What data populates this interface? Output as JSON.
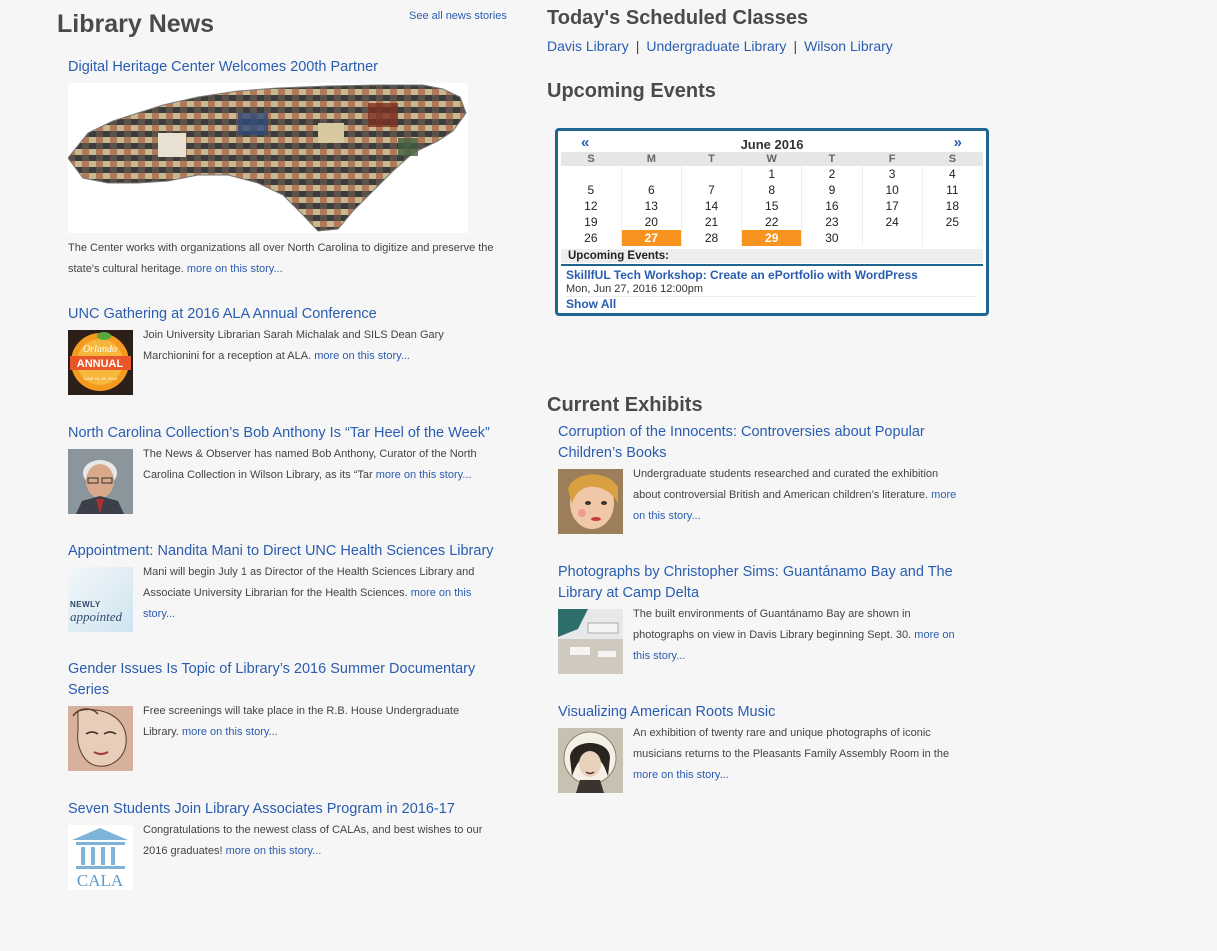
{
  "news": {
    "heading": "Library News",
    "see_all": "See all news stories",
    "more_label": "more on this story...",
    "stories": [
      {
        "title": "Digital Heritage Center Welcomes 200th Partner",
        "text": "The Center works with organizations all over North Carolina to digitize and preserve the state's cultural heritage."
      },
      {
        "title": "UNC Gathering at 2016 ALA Annual Conference",
        "text": "Join University Librarian Sarah Michalak and SILS Dean Gary Marchionini for a reception at ALA."
      },
      {
        "title": "North Carolina Collection’s Bob Anthony Is “Tar Heel of the Week”",
        "text": "The News & Observer has named Bob Anthony, Curator of the North Carolina Collection in Wilson Library, as its “Tar"
      },
      {
        "title": "Appointment: Nandita Mani to Direct UNC Health Sciences Library",
        "text": "Mani will begin July 1 as Director of the Health Sciences Library and Associate University Librarian for the Health Sciences."
      },
      {
        "title": "Gender Issues Is Topic of Library’s 2016 Summer Documentary Series",
        "text": "Free screenings will take place in the R.B. House Undergraduate Library."
      },
      {
        "title": "Seven Students Join Library Associates Program in 2016-17",
        "text": "Congratulations to the newest class of CALAs, and best wishes to our 2016 graduates!"
      }
    ],
    "thumb_text": {
      "ala_top": "Orlando",
      "ala_main": "ANNUAL",
      "ala_dates": "JUNE 23–28, 2016",
      "newly": "NEWLY",
      "appointed": "appointed",
      "cala": "CALA"
    }
  },
  "classes": {
    "heading": "Today's Scheduled Classes",
    "libraries": [
      "Davis Library",
      "Undergraduate Library",
      "Wilson Library"
    ],
    "separator": "|"
  },
  "events": {
    "heading": "Upcoming Events",
    "calendar": {
      "prev": "«",
      "next": "»",
      "month": "June 2016",
      "weekdays": [
        "S",
        "M",
        "T",
        "W",
        "T",
        "F",
        "S"
      ],
      "weeks": [
        [
          "",
          "",
          "",
          "1",
          "2",
          "3",
          "4"
        ],
        [
          "5",
          "6",
          "7",
          "8",
          "9",
          "10",
          "11"
        ],
        [
          "12",
          "13",
          "14",
          "15",
          "16",
          "17",
          "18"
        ],
        [
          "19",
          "20",
          "21",
          "22",
          "23",
          "24",
          "25"
        ],
        [
          "26",
          "27",
          "28",
          "29",
          "30",
          "",
          ""
        ]
      ],
      "highlighted": [
        "27",
        "29"
      ],
      "highlight_color": "#f7931e"
    },
    "upcoming_label": "Upcoming Events:",
    "event_title": "SkillfUL Tech Workshop: Create an ePortfolio with WordPress",
    "event_time": "Mon, Jun 27, 2016 12:00pm",
    "show_all": "Show All"
  },
  "exhibits": {
    "heading": "Current Exhibits",
    "more_label": "more on this story...",
    "items": [
      {
        "title": "Corruption of the Innocents: Controversies about Popular Children’s Books",
        "text": "Undergraduate students researched and curated the exhibition about controversial British and American children’s literature."
      },
      {
        "title": "Photographs by Christopher Sims: Guantánamo Bay and The Library at Camp Delta",
        "text": "The built environments of Guantánamo Bay are shown in photographs on view in Davis Library beginning Sept. 30."
      },
      {
        "title": "Visualizing American Roots Music",
        "text": "An exhibition of twenty rare and unique photographs of iconic musicians returns to the Pleasants Family Assembly Room in the"
      }
    ]
  },
  "colors": {
    "link": "#2a5db0",
    "heading": "#4a4a4a",
    "calendar_border": "#1e6592",
    "background": "#f6f6f6"
  }
}
